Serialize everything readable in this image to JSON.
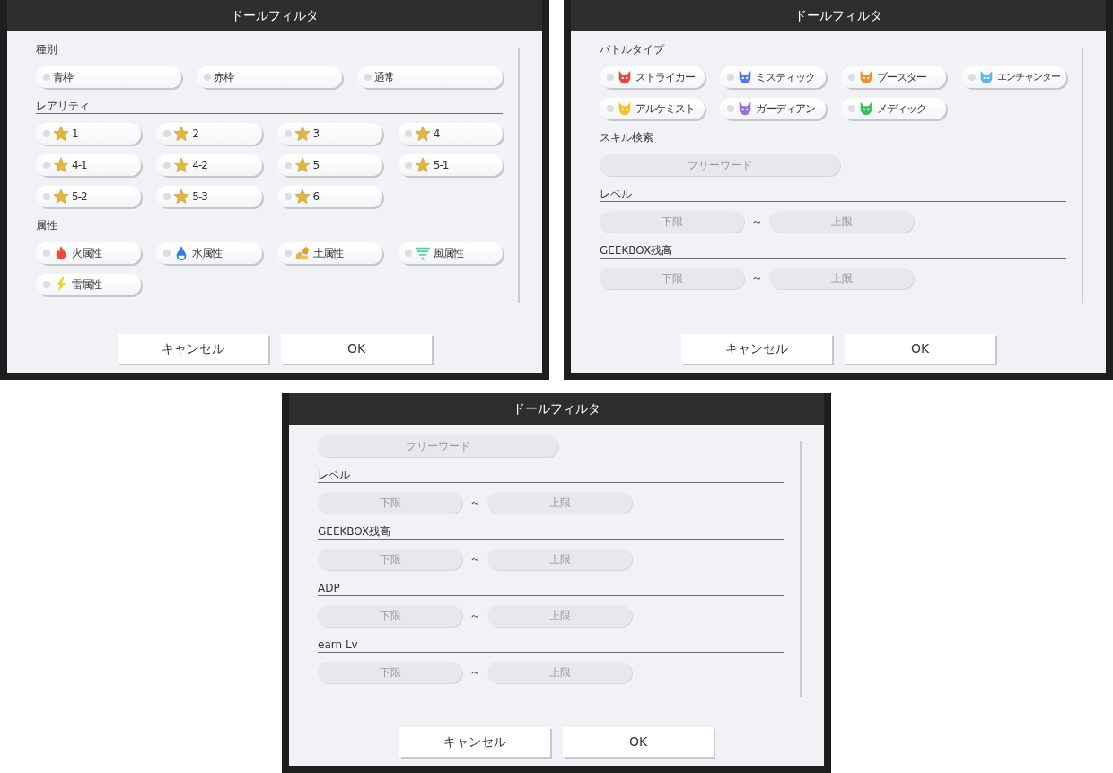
{
  "panels": [
    {
      "title": "ドールフィルタ",
      "sections": [
        {
          "kind": "options",
          "heading": "種別",
          "items": [
            {
              "label": "青枠",
              "kind": "plain",
              "selected": false
            },
            {
              "label": "赤枠",
              "kind": "plain",
              "selected": false
            },
            {
              "label": "通常",
              "kind": "plain",
              "selected": false
            }
          ]
        },
        {
          "kind": "options",
          "heading": "レアリティ",
          "items": [
            {
              "label": "1",
              "kind": "star",
              "selected": false
            },
            {
              "label": "2",
              "kind": "star",
              "selected": false
            },
            {
              "label": "3",
              "kind": "star",
              "selected": false
            },
            {
              "label": "4",
              "kind": "star",
              "selected": false
            },
            {
              "label": "4-1",
              "kind": "star",
              "selected": false
            },
            {
              "label": "4-2",
              "kind": "star",
              "selected": false
            },
            {
              "label": "5",
              "kind": "star",
              "selected": false
            },
            {
              "label": "5-1",
              "kind": "star",
              "selected": false
            },
            {
              "label": "5-2",
              "kind": "star",
              "selected": false
            },
            {
              "label": "5-3",
              "kind": "star",
              "selected": false
            },
            {
              "label": "6",
              "kind": "star",
              "selected": false
            }
          ]
        },
        {
          "kind": "options",
          "heading": "属性",
          "items": [
            {
              "label": "火属性",
              "kind": "fire",
              "selected": false
            },
            {
              "label": "水属性",
              "kind": "water",
              "selected": false
            },
            {
              "label": "土属性",
              "kind": "earth",
              "selected": false
            },
            {
              "label": "風属性",
              "kind": "wind",
              "selected": false
            },
            {
              "label": "雷属性",
              "kind": "thunder",
              "selected": false
            }
          ]
        }
      ],
      "buttons": [
        "キャンセル",
        "OK"
      ]
    },
    {
      "title": "ドールフィルタ",
      "sections": [
        {
          "kind": "options",
          "heading": "バトルタイプ",
          "items": [
            {
              "label": "ストライカー",
              "kind": "striker",
              "selected": false
            },
            {
              "label": "ミスティック",
              "kind": "mystic",
              "selected": false
            },
            {
              "label": "ブースター",
              "kind": "booster",
              "selected": false
            },
            {
              "label": "エンチャンター",
              "kind": "enchanter",
              "selected": false
            },
            {
              "label": "アルケミスト",
              "kind": "alchemist",
              "selected": false
            },
            {
              "label": "ガーディアン",
              "kind": "guardian",
              "selected": false
            },
            {
              "label": "メディック",
              "kind": "medic",
              "selected": false
            }
          ]
        },
        {
          "kind": "text",
          "heading": "スキル検索",
          "placeholder": "フリーワード"
        },
        {
          "kind": "range",
          "heading": "レベル",
          "min_placeholder": "下限",
          "separator": "～",
          "max_placeholder": "上限"
        },
        {
          "kind": "range",
          "heading": "GEEKBOX残高",
          "min_placeholder": "下限",
          "separator": "～",
          "max_placeholder": "上限"
        }
      ],
      "buttons": [
        "キャンセル",
        "OK"
      ]
    },
    {
      "title": "ドールフィルタ",
      "sections": [
        {
          "kind": "text",
          "placeholder": "フリーワード"
        },
        {
          "kind": "range",
          "heading": "レベル",
          "min_placeholder": "下限",
          "separator": "～",
          "max_placeholder": "上限"
        },
        {
          "kind": "range",
          "heading": "GEEKBOX残高",
          "min_placeholder": "下限",
          "separator": "～",
          "max_placeholder": "上限"
        },
        {
          "kind": "range",
          "heading": "ADP",
          "min_placeholder": "下限",
          "separator": "～",
          "max_placeholder": "上限"
        },
        {
          "kind": "range",
          "heading": "earn Lv",
          "min_placeholder": "下限",
          "separator": "～",
          "max_placeholder": "上限"
        }
      ],
      "buttons": [
        "キャンセル",
        "OK"
      ]
    }
  ]
}
